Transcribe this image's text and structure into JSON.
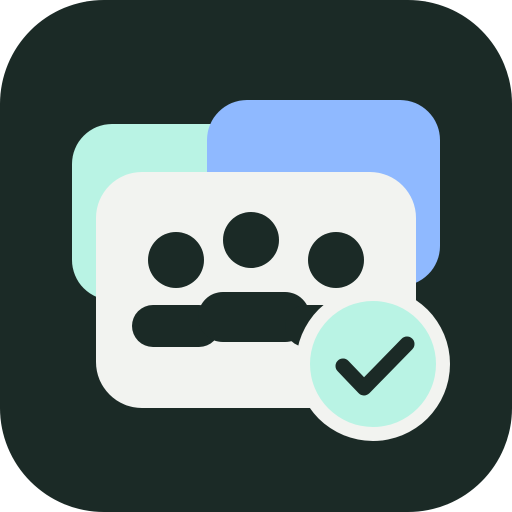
{
  "app_icon": {
    "icon_name": "group-chat-check-icon",
    "colors": {
      "background": "#1b2a26",
      "card_back_left": "#b9f3e4",
      "card_back_right": "#8fb9ff",
      "card_front": "#f2f3f0",
      "people": "#1b2a26",
      "badge": "#b9f3e4",
      "checkmark": "#1b2a26"
    }
  }
}
